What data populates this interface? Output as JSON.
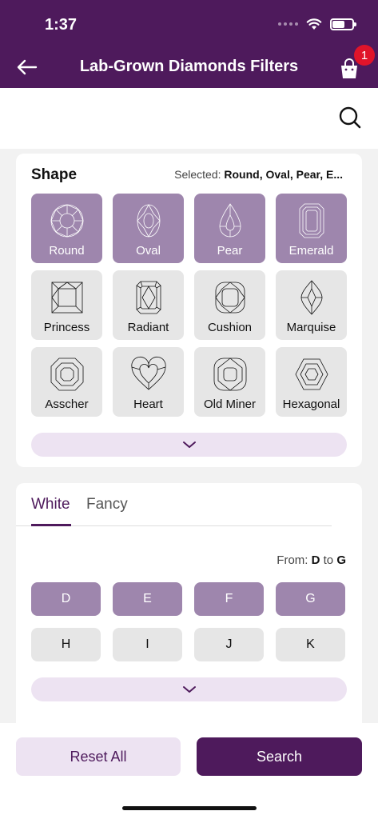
{
  "status": {
    "time": "1:37",
    "battery_level": 0.65
  },
  "header": {
    "title": "Lab-Grown Diamonds Filters",
    "cart_count": "1"
  },
  "shape": {
    "title": "Shape",
    "selected_label": "Selected:",
    "selected_value": "Round, Oval, Pear, E...",
    "items": [
      {
        "label": "Round",
        "selected": true,
        "icon": "round-diamond-icon"
      },
      {
        "label": "Oval",
        "selected": true,
        "icon": "oval-diamond-icon"
      },
      {
        "label": "Pear",
        "selected": true,
        "icon": "pear-diamond-icon"
      },
      {
        "label": "Emerald",
        "selected": true,
        "icon": "emerald-diamond-icon"
      },
      {
        "label": "Princess",
        "selected": false,
        "icon": "princess-diamond-icon"
      },
      {
        "label": "Radiant",
        "selected": false,
        "icon": "radiant-diamond-icon"
      },
      {
        "label": "Cushion",
        "selected": false,
        "icon": "cushion-diamond-icon"
      },
      {
        "label": "Marquise",
        "selected": false,
        "icon": "marquise-diamond-icon"
      },
      {
        "label": "Asscher",
        "selected": false,
        "icon": "asscher-diamond-icon"
      },
      {
        "label": "Heart",
        "selected": false,
        "icon": "heart-diamond-icon"
      },
      {
        "label": "Old Miner",
        "selected": false,
        "icon": "old-miner-diamond-icon"
      },
      {
        "label": "Hexagonal",
        "selected": false,
        "icon": "hexagonal-diamond-icon"
      }
    ]
  },
  "color": {
    "tabs": [
      {
        "label": "White",
        "active": true
      },
      {
        "label": "Fancy",
        "active": false
      }
    ],
    "range_label": "From:",
    "range_from": "D",
    "range_to_label": "to",
    "range_to": "G",
    "grades": [
      {
        "label": "D",
        "selected": true
      },
      {
        "label": "E",
        "selected": true
      },
      {
        "label": "F",
        "selected": true
      },
      {
        "label": "G",
        "selected": true
      },
      {
        "label": "H",
        "selected": false
      },
      {
        "label": "I",
        "selected": false
      },
      {
        "label": "J",
        "selected": false
      },
      {
        "label": "K",
        "selected": false
      }
    ]
  },
  "footer": {
    "reset_label": "Reset All",
    "search_label": "Search"
  },
  "colors": {
    "primary": "#4e1a5c",
    "selected_tile": "#9e86ad",
    "tile": "#e6e6e6",
    "light_accent": "#ede3f2",
    "badge": "#e0142a"
  }
}
